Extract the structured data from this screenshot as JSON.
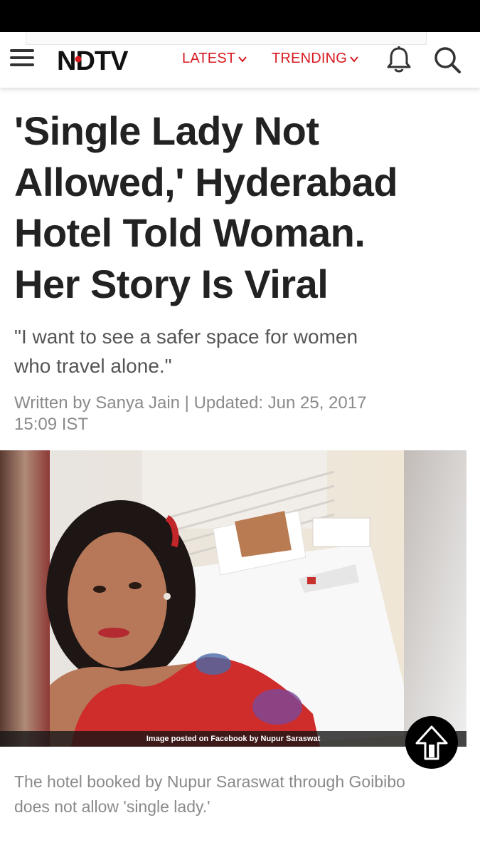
{
  "header": {
    "logo_text": "NDTV",
    "nav": [
      {
        "label": "LATEST"
      },
      {
        "label": "TRENDING"
      }
    ],
    "accent_color": "#d71920"
  },
  "icons": [
    "menu-icon",
    "ndtv-logo",
    "chevron-down-icon",
    "bell-icon",
    "search-icon",
    "arrow-up-icon"
  ],
  "article": {
    "headline_lines": [
      "'Single Lady Not",
      "Allowed,' Hyderabad",
      "Hotel Told Woman.",
      "Her Story Is Viral"
    ],
    "subheadline_lines": [
      "\"I want to see a safer space for women",
      "who travel alone.\""
    ],
    "byline_lines": [
      "Written by Sanya Jain | Updated: Jun 25, 2017",
      "15:09 IST"
    ],
    "image_credit": "Image posted on Facebook by Nupur Saraswat",
    "image_caption_lines": [
      "The hotel booked by Nupur Saraswat through Goibibo",
      "does not allow 'single lady.'"
    ]
  }
}
